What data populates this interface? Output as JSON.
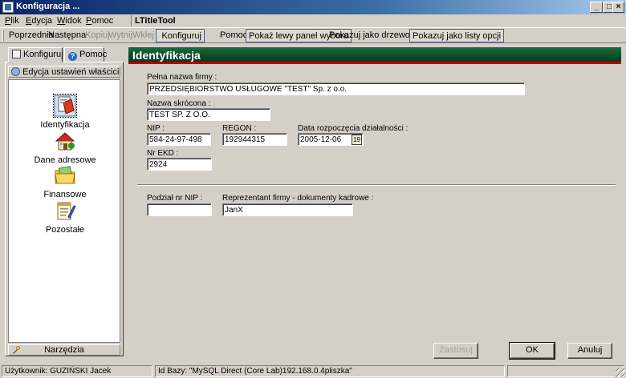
{
  "window": {
    "title": "Konfiguracja ..."
  },
  "menu": {
    "items": [
      {
        "u": "P",
        "rest": "lik"
      },
      {
        "u": "E",
        "rest": "dycja"
      },
      {
        "u": "W",
        "rest": "idok"
      },
      {
        "u": "P",
        "rest": "omoc"
      }
    ],
    "tool_title": "LTitleTool"
  },
  "toolbar": {
    "poprzednia": "Poprzednia",
    "nastepna": "Następna",
    "kopiuj": "Kopiuj",
    "wytnij": "Wytnij",
    "wklej": "Wklej",
    "konfiguruj": "Konfiguruj",
    "pomoc": "Pomoc",
    "pokaz_panel": "Pokaż lewy panel wyboru",
    "pokazuj_drzewo": "Pokazuj jako drzewo opcji",
    "pokazuj_listy": "Pokazuj jako listy opcji"
  },
  "left_panel": {
    "tabs": [
      "Konfiguruj",
      "Pomoc"
    ],
    "header": "Edycja ustawień właściciela ...",
    "items": [
      "Identyfikacja",
      "Dane adresowe",
      "Finansowe",
      "Pozostałe"
    ],
    "footer": "Narzędzia"
  },
  "form": {
    "title": "Identyfikacja",
    "pelna_nazwa": {
      "label": "Pełna nazwa firmy :",
      "value": "PRZEDSIĘBIORSTWO USŁUGOWE \"TEST\" Sp. z o.o."
    },
    "nazwa_skrocona": {
      "label": "Nazwa skrócona :",
      "value": "TEST SP. Z O.O."
    },
    "nip": {
      "label": "NIP :",
      "value": "584-24-97-498"
    },
    "regon": {
      "label": "REGON :",
      "value": "192944315"
    },
    "data_rozpoczecia": {
      "label": "Data rozpoczęcia działalności :",
      "value": "2005-12-06"
    },
    "nr_ekd": {
      "label": "Nr EKD :",
      "value": "2924"
    },
    "podzial_nip": {
      "label": "Podział nr NIP :",
      "value": ""
    },
    "reprezentant": {
      "label": "Reprezentant firmy - dokumenty kadrowe :",
      "value": "JanX"
    }
  },
  "buttons": {
    "zastosuj": "Zastosuj",
    "ok": "OK",
    "anuluj": "Anuluj"
  },
  "status": {
    "user": "Użytkownik: GUZIŃSKI Jacek",
    "db": "Id Bazy: \"MySQL Direct (Core Lab)192.168.0.4pliszka\""
  }
}
